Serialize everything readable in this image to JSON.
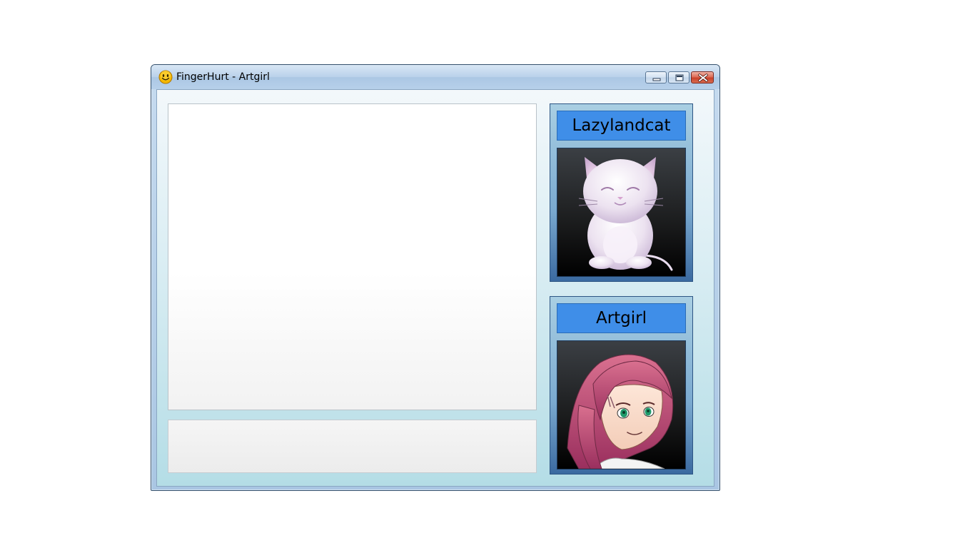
{
  "window": {
    "title": "FingerHurt - Artgirl",
    "app_icon": "smiley-face-icon",
    "caption_buttons": [
      "minimize-icon",
      "maximize-icon",
      "close-icon"
    ]
  },
  "chat": {
    "log_text": "",
    "input_value": ""
  },
  "contacts": [
    {
      "name": "Lazylandcat",
      "avatar": "white-cat-avatar"
    },
    {
      "name": "Artgirl",
      "avatar": "anime-girl-avatar"
    }
  ],
  "colors": {
    "name_banner": "#3f8ee8",
    "card_border": "#2d5584",
    "close_button": "#c9432b"
  }
}
